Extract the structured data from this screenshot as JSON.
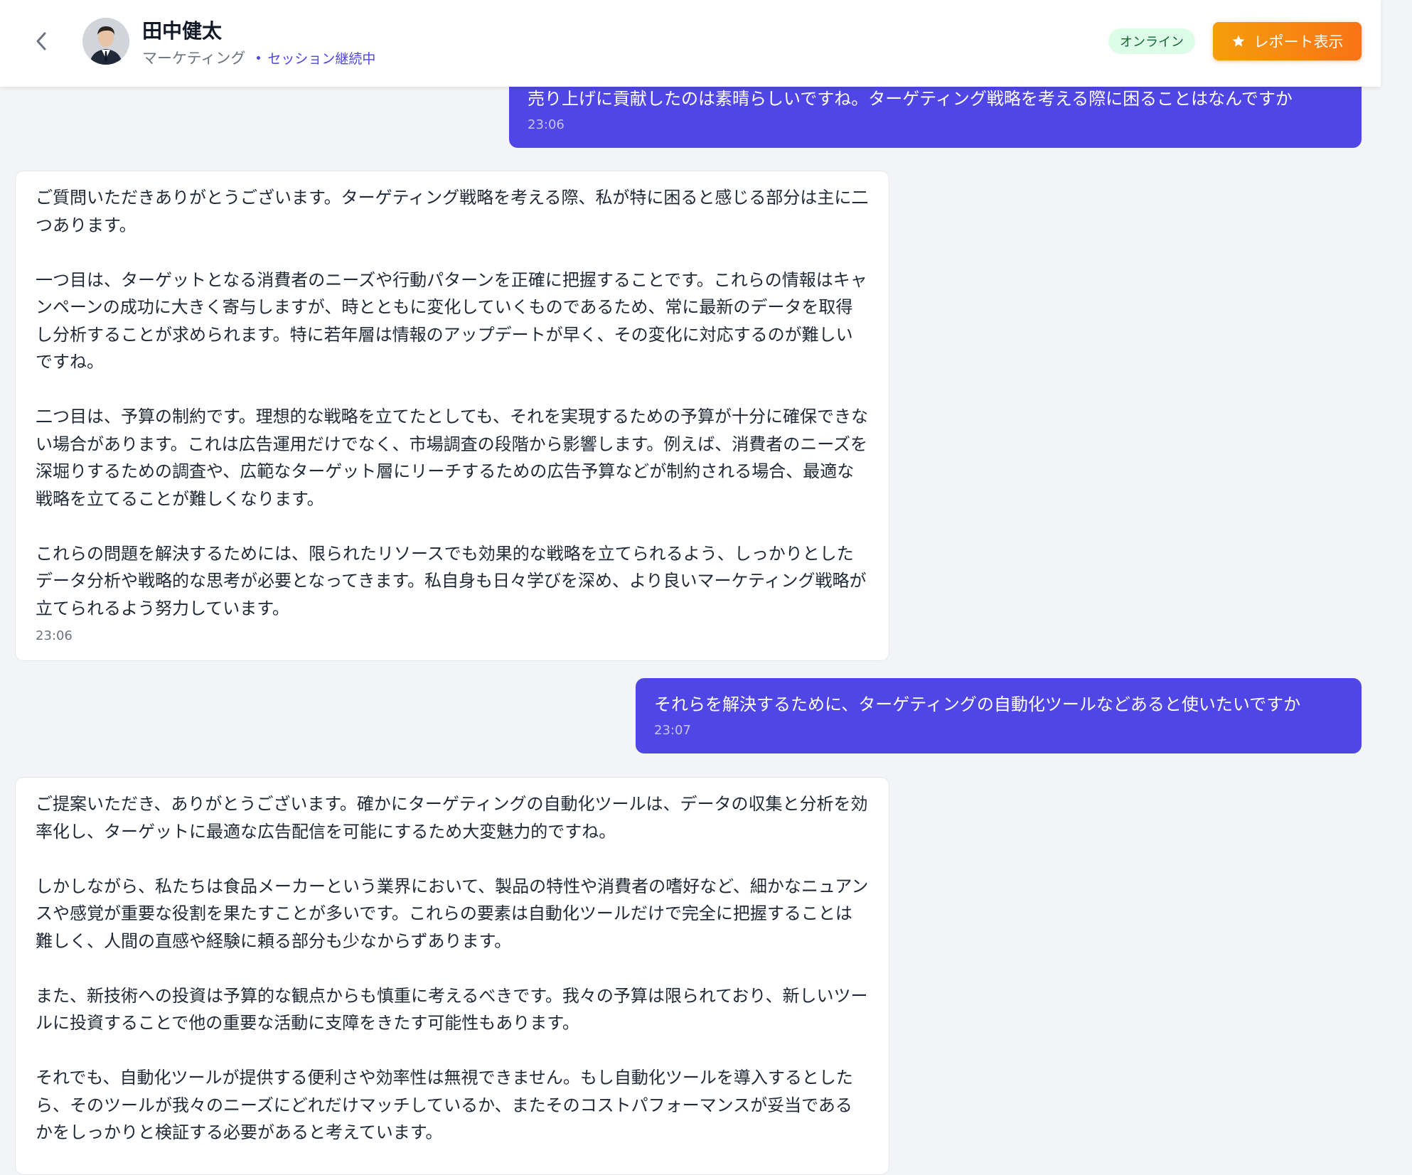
{
  "header": {
    "name": "田中健太",
    "department": "マーケティング",
    "session_status": "セッション継続中",
    "online_label": "オンライン",
    "report_button_label": "レポート表示"
  },
  "colors": {
    "accent": "#4f46e5",
    "user_bubble": "#4f46e5",
    "report_gradient_start": "#f59e0b",
    "report_gradient_end": "#f97316",
    "online_bg": "#dcfce7"
  },
  "icons": {
    "back": "chevron-left-icon",
    "report": "star-icon",
    "avatar": "person-avatar"
  },
  "messages": [
    {
      "role": "user",
      "text": "売り上げに貢献したのは素晴らしいですね。ターゲティング戦略を考える際に困ることはなんですか",
      "time": "23:06"
    },
    {
      "role": "bot",
      "paragraphs": [
        "ご質問いただきありがとうございます。ターゲティング戦略を考える際、私が特に困ると感じる部分は主に二つあります。",
        "一つ目は、ターゲットとなる消費者のニーズや行動パターンを正確に把握することです。これらの情報はキャンペーンの成功に大きく寄与しますが、時とともに変化していくものであるため、常に最新のデータを取得し分析することが求められます。特に若年層は情報のアップデートが早く、その変化に対応するのが難しいですね。",
        "二つ目は、予算の制約です。理想的な戦略を立てたとしても、それを実現するための予算が十分に確保できない場合があります。これは広告運用だけでなく、市場調査の段階から影響します。例えば、消費者のニーズを深堀りするための調査や、広範なターゲット層にリーチするための広告予算などが制約される場合、最適な戦略を立てることが難しくなります。",
        "これらの問題を解決するためには、限られたリソースでも効果的な戦略を立てられるよう、しっかりとしたデータ分析や戦略的な思考が必要となってきます。私自身も日々学びを深め、より良いマーケティング戦略が立てられるよう努力しています。"
      ],
      "time": "23:06"
    },
    {
      "role": "user",
      "text": "それらを解決するために、ターゲティングの自動化ツールなどあると使いたいですか",
      "time": "23:07"
    },
    {
      "role": "bot",
      "paragraphs": [
        "ご提案いただき、ありがとうございます。確かにターゲティングの自動化ツールは、データの収集と分析を効率化し、ターゲットに最適な広告配信を可能にするため大変魅力的ですね。",
        "しかしながら、私たちは食品メーカーという業界において、製品の特性や消費者の嗜好など、細かなニュアンスや感覚が重要な役割を果たすことが多いです。これらの要素は自動化ツールだけで完全に把握することは難しく、人間の直感や経験に頼る部分も少なからずあります。",
        "また、新技術への投資は予算的な観点からも慎重に考えるべきです。我々の予算は限られており、新しいツールに投資することで他の重要な活動に支障をきたす可能性もあります。",
        "それでも、自動化ツールが提供する便利さや効率性は無視できません。もし自動化ツールを導入するとしたら、そのツールが我々のニーズにどれだけマッチしているか、またそのコストパフォーマンスが妥当であるかをしっかりと検証する必要があると考えています。"
      ]
    }
  ]
}
